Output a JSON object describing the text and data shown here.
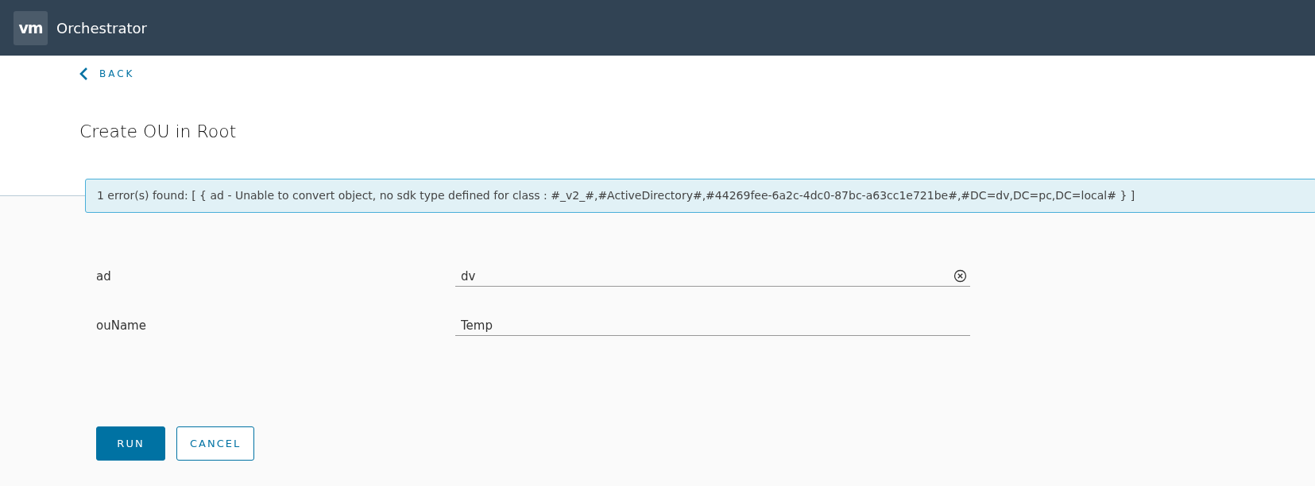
{
  "header": {
    "logo": "vm",
    "title": "Orchestrator"
  },
  "back_link": "BACK",
  "page_title": "Create OU in Root",
  "error": "1 error(s) found: [ { ad - Unable to convert object, no sdk type defined for class : #_v2_#,#ActiveDirectory#,#44269fee-6a2c-4dc0-87bc-a63cc1e721be#,#DC=dv,DC=pc,DC=local# } ]",
  "fields": [
    {
      "label": "ad",
      "value": "dv",
      "clearable": true
    },
    {
      "label": "ouName",
      "value": "Temp",
      "clearable": false
    }
  ],
  "buttons": [
    {
      "label": "RUN",
      "kind": "primary"
    },
    {
      "label": "CANCEL",
      "kind": "outline"
    }
  ]
}
